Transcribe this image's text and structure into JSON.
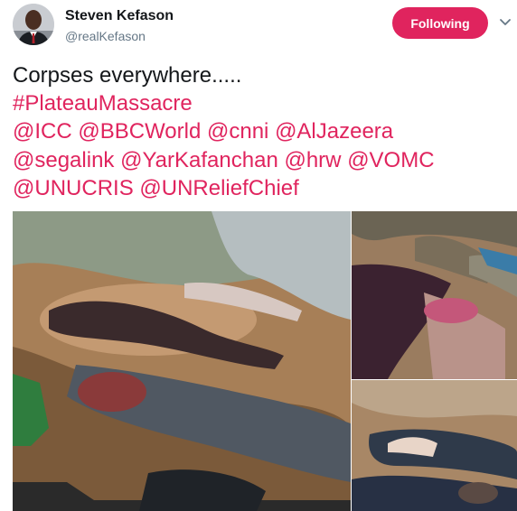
{
  "author": {
    "display_name": "Steven Kefason",
    "handle": "@realKefason",
    "follow_label": "Following"
  },
  "tweet": {
    "lines": [
      [
        {
          "text": "Corpses everywhere.....",
          "link": false
        }
      ],
      [
        {
          "text": "#PlateauMassacre",
          "link": true
        }
      ],
      [
        {
          "text": "@ICC",
          "link": true
        },
        {
          "text": " ",
          "link": false
        },
        {
          "text": "@BBCWorld",
          "link": true
        },
        {
          "text": " ",
          "link": false
        },
        {
          "text": "@cnni",
          "link": true
        },
        {
          "text": " ",
          "link": false
        },
        {
          "text": "@AlJazeera",
          "link": true
        }
      ],
      [
        {
          "text": "@segalink",
          "link": true
        },
        {
          "text": " ",
          "link": false
        },
        {
          "text": "@YarKafanchan",
          "link": true
        },
        {
          "text": " ",
          "link": false
        },
        {
          "text": "@hrw",
          "link": true
        },
        {
          "text": " ",
          "link": false
        },
        {
          "text": "@VOMC",
          "link": true
        }
      ],
      [
        {
          "text": "@UNUCRIS",
          "link": true
        },
        {
          "text": " ",
          "link": false
        },
        {
          "text": "@UNReliefChief",
          "link": true
        }
      ]
    ]
  },
  "colors": {
    "accent": "#e0245e",
    "text": "#14171a",
    "secondary": "#657786"
  },
  "icons": {
    "menu": "chevron-down-icon"
  }
}
